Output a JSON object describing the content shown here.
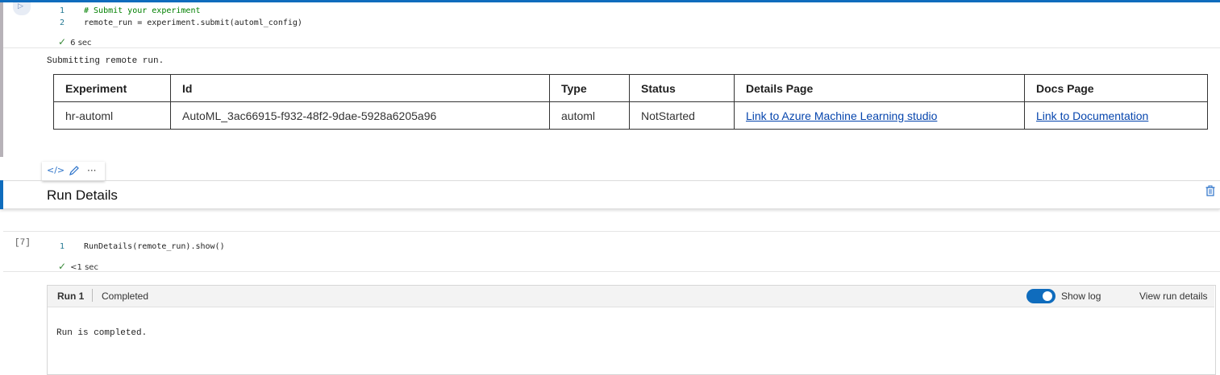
{
  "cell1": {
    "run_icon": "play-icon",
    "lines": [
      {
        "num": "1",
        "text": "# Submit your experiment"
      },
      {
        "num": "2",
        "text": "remote_run = experiment.submit(automl_config)"
      }
    ],
    "exec_time": "6 sec",
    "output_text": "Submitting remote run.",
    "table": {
      "headers": [
        "Experiment",
        "Id",
        "Type",
        "Status",
        "Details Page",
        "Docs Page"
      ],
      "row": [
        "hr-automl",
        "AutoML_3ac66915-f932-48f2-9dae-5928a6205a96",
        "automl",
        "NotStarted",
        "Link to Azure Machine Learning studio",
        "Link to Documentation"
      ]
    }
  },
  "floating_toolbar": {
    "code_icon": "</>",
    "edit_icon": "pencil-icon",
    "more_icon": "···"
  },
  "markdown_cell": {
    "title": "Run Details",
    "delete_icon": "trash-icon"
  },
  "cell2": {
    "exec_count": "[7]",
    "lines": [
      {
        "num": "1",
        "text": "RunDetails(remote_run).show()"
      }
    ],
    "exec_time": "<1 sec"
  },
  "widget": {
    "run_label": "Run 1",
    "status": "Completed",
    "show_log_label": "Show log",
    "show_log_on": true,
    "view_details": "View run details",
    "log_text": "Run is completed."
  },
  "colors": {
    "accent": "#0f6cbd",
    "link": "#0645ad",
    "comment": "#008000"
  }
}
